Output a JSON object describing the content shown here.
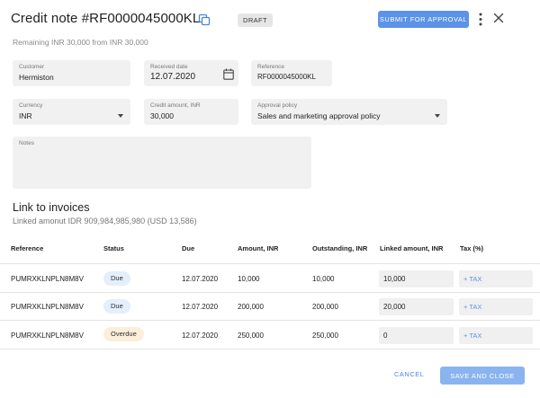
{
  "header": {
    "title": "Credit note #RF0000045000KL",
    "status_badge": "DRAFT",
    "submit_label": "SUBMIT FOR APPROVAL",
    "remaining_text": "Remaining INR 30,000 from INR 30,000"
  },
  "form": {
    "customer": {
      "label": "Customer",
      "value": "Hermiston"
    },
    "received_date": {
      "label": "Received date",
      "value": "12.07.2020"
    },
    "reference": {
      "label": "Reference",
      "value": "RF0000045000KL"
    },
    "currency": {
      "label": "Currency",
      "value": "INR"
    },
    "credit_amount": {
      "label": "Credit amount, INR",
      "value": "30,000"
    },
    "approval_policy": {
      "label": "Approval policy",
      "value": "Sales and marketing approval policy"
    },
    "notes": {
      "label": "Notes",
      "value": ""
    }
  },
  "invoices": {
    "title": "Link to invoices",
    "linked_amount_text": "Linked amonut IDR 909,984,985,980  (USD 13,586)",
    "columns": [
      "Reference",
      "Status",
      "Due",
      "Amount, INR",
      "Outstanding, INR",
      "Linked amount, INR",
      "Tax (%)"
    ],
    "rows": [
      {
        "reference": "PUMRXKLNPLN8M8V",
        "status": "Due",
        "status_color": "#e4effc",
        "due": "12.07.2020",
        "amount": "10,000",
        "outstanding": "10,000",
        "linked": "10,000",
        "tax": "+ TAX"
      },
      {
        "reference": "PUMRXKLNPLN8M8V",
        "status": "Due",
        "status_color": "#e4effc",
        "due": "12.07.2020",
        "amount": "200,000",
        "outstanding": "200,000",
        "linked": "20,000",
        "tax": "+ TAX"
      },
      {
        "reference": "PUMRXKLNPLN8M8V",
        "status": "Overdue",
        "status_color": "#fcefd9",
        "due": "12.07.2020",
        "amount": "250,000",
        "outstanding": "250,000",
        "linked": "0",
        "tax": "+ TAX"
      }
    ]
  },
  "footer": {
    "cancel_label": "CANCEL",
    "save_label": "SAVE AND CLOSE"
  },
  "colors": {
    "accent": "#5b93e6",
    "save_button": "#8ab4ef",
    "field_bg": "#f1f1f1"
  },
  "icons": [
    "copy-icon",
    "more-vert-icon",
    "close-icon",
    "calendar-icon",
    "chevron-down-icon"
  ]
}
